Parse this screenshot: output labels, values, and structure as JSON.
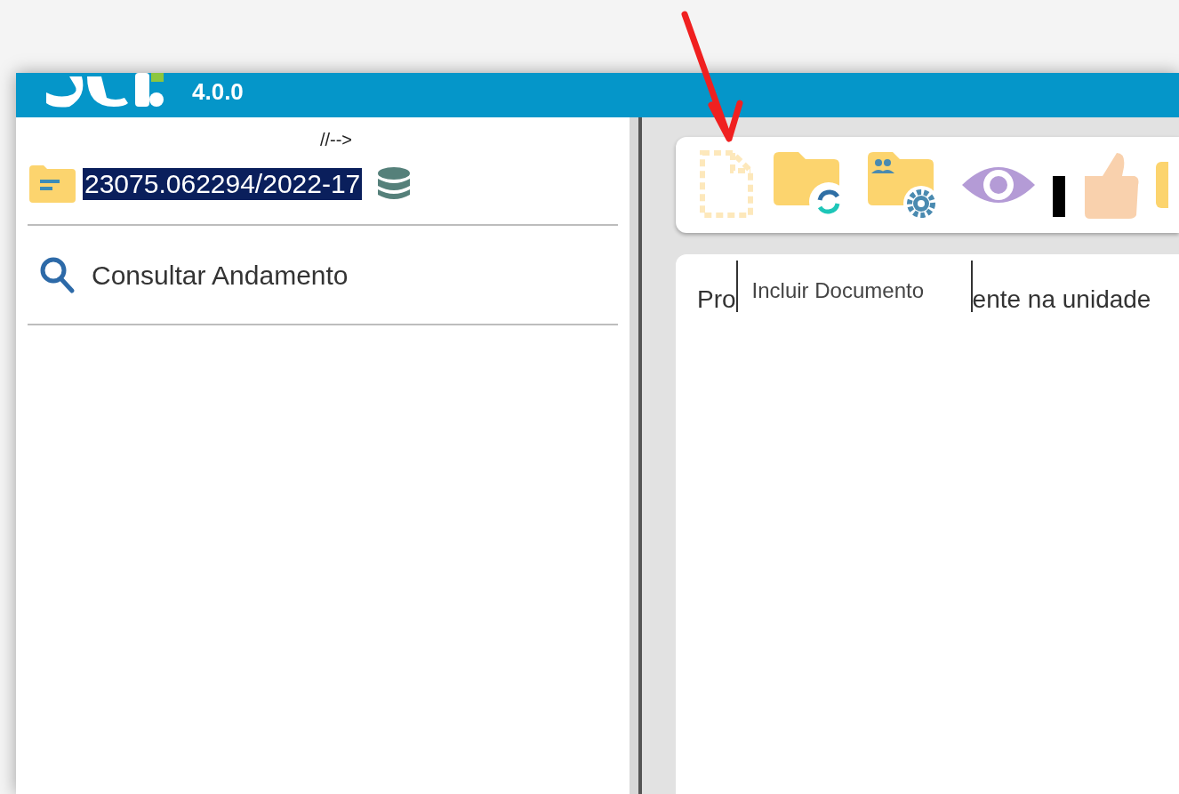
{
  "header": {
    "version": "4.0.0"
  },
  "left_panel": {
    "comment": "//-->",
    "process_number": {
      "text": "23075.062294/2022-17",
      "selected": true
    },
    "menu": [
      {
        "label": "Consultar Andamento"
      }
    ]
  },
  "toolbar": {
    "buttons": [
      {
        "kind": "new-document",
        "disabled": true
      },
      {
        "kind": "folder-sync",
        "disabled": false
      },
      {
        "kind": "folder-people-gear",
        "disabled": false
      },
      {
        "kind": "eye",
        "disabled": false
      },
      {
        "kind": "bar",
        "disabled": false
      },
      {
        "kind": "thumb",
        "disabled": false
      },
      {
        "kind": "folder-edge",
        "disabled": false
      }
    ]
  },
  "content": {
    "text_before": "Pro",
    "text_after": "ente na unidade",
    "tooltip": "Incluir Documento"
  },
  "annotation": {
    "kind": "arrow"
  }
}
